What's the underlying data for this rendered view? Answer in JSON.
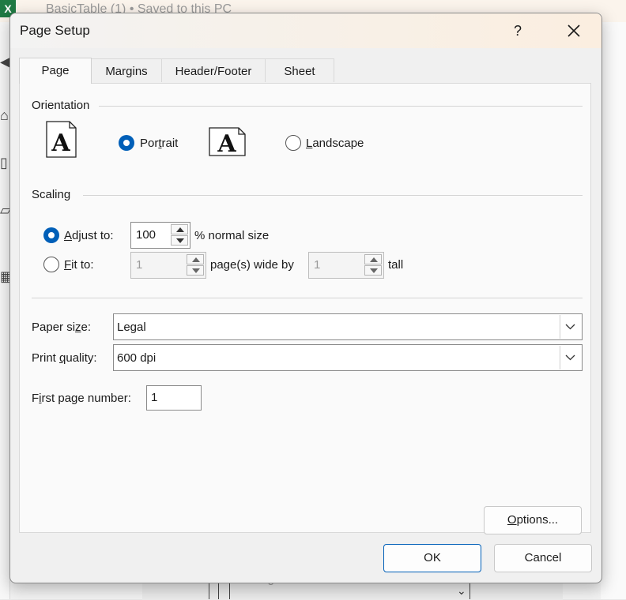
{
  "background": {
    "window_title": "BasicTable (1) • Saved to this PC",
    "app_badge": "X",
    "bottom_text": "Legal"
  },
  "dialog": {
    "title": "Page Setup",
    "help_label": "?"
  },
  "tabs": [
    {
      "label": "Page",
      "active": true
    },
    {
      "label": "Margins",
      "active": false
    },
    {
      "label": "Header/Footer",
      "active": false
    },
    {
      "label": "Sheet",
      "active": false
    }
  ],
  "orientation": {
    "section_label": "Orientation",
    "icon_letter": "A",
    "portrait_label_pre": "Por",
    "portrait_label_key": "t",
    "portrait_label_post": "rait",
    "landscape_label_key": "L",
    "landscape_label_post": "andscape",
    "selected": "portrait"
  },
  "scaling": {
    "section_label": "Scaling",
    "adjust_label_key": "A",
    "adjust_label_post": "djust to:",
    "adjust_value": "100",
    "adjust_suffix": "% normal size",
    "fit_label_key": "F",
    "fit_label_post": "it to:",
    "fit_wide_value": "1",
    "fit_wide_suffix": "page(s) wide by",
    "fit_tall_value": "1",
    "fit_tall_suffix": "tall",
    "selected": "adjust"
  },
  "paper_size": {
    "label_pre": "Paper si",
    "label_key": "z",
    "label_post": "e:",
    "value": "Legal"
  },
  "print_quality": {
    "label_pre": "Print ",
    "label_key": "q",
    "label_post": "uality:",
    "value": "600 dpi"
  },
  "first_page": {
    "label_pre": "F",
    "label_key": "i",
    "label_post": "rst page number:",
    "value": "1"
  },
  "buttons": {
    "options_key": "O",
    "options_post": "ptions...",
    "ok": "OK",
    "cancel": "Cancel"
  },
  "colors": {
    "accent": "#005fb8"
  }
}
